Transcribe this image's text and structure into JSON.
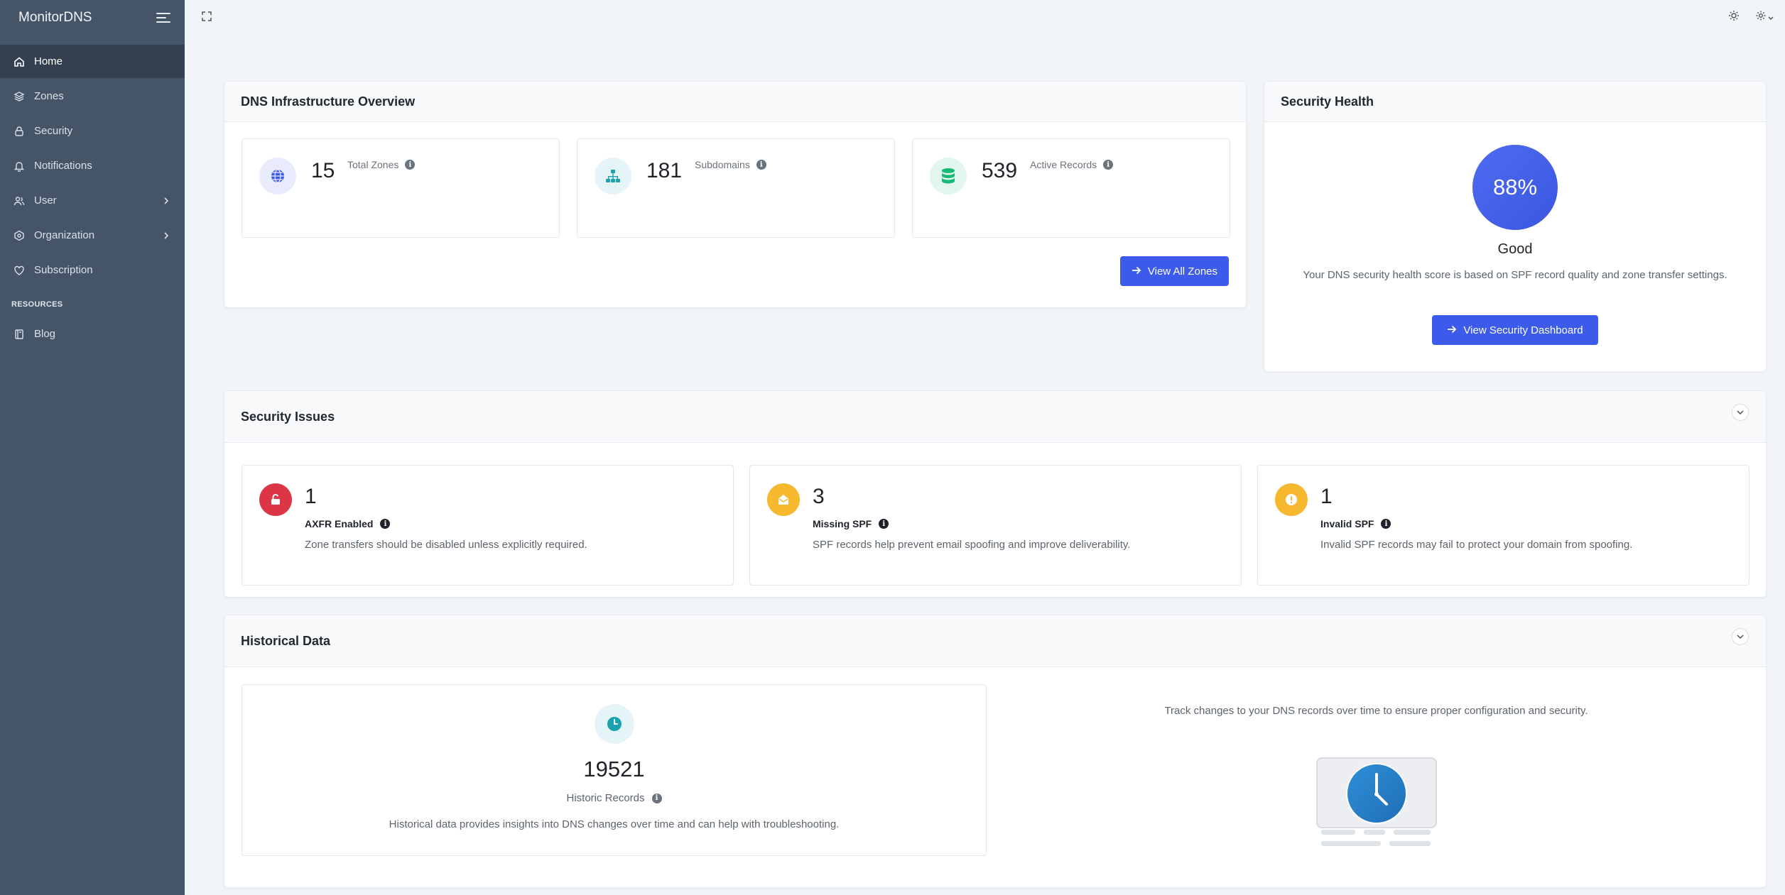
{
  "sidebar": {
    "brand": "MonitorDNS",
    "items": [
      {
        "label": "Home",
        "icon": "home-icon"
      },
      {
        "label": "Zones",
        "icon": "layers-icon"
      },
      {
        "label": "Security",
        "icon": "lock-icon"
      },
      {
        "label": "Notifications",
        "icon": "bell-icon"
      },
      {
        "label": "User",
        "icon": "users-icon"
      },
      {
        "label": "Organization",
        "icon": "organization-icon"
      },
      {
        "label": "Subscription",
        "icon": "heart-icon"
      }
    ],
    "section": "RESOURCES",
    "resources": [
      {
        "label": "Blog",
        "icon": "book-icon"
      }
    ]
  },
  "overview": {
    "title": "DNS Infrastructure Overview",
    "stats": [
      {
        "value": "15",
        "label": "Total Zones"
      },
      {
        "value": "181",
        "label": "Subdomains"
      },
      {
        "value": "539",
        "label": "Active Records"
      }
    ],
    "button": "View All Zones"
  },
  "health": {
    "title": "Security Health",
    "score": "88%",
    "score_value": 88,
    "status": "Good",
    "description": "Your DNS security health score is based on SPF record quality and zone transfer settings.",
    "button": "View Security Dashboard"
  },
  "issues": {
    "title": "Security Issues",
    "items": [
      {
        "value": "1",
        "label": "AXFR Enabled",
        "desc": "Zone transfers should be disabled unless explicitly required.",
        "color": "#dc3545"
      },
      {
        "value": "3",
        "label": "Missing SPF",
        "desc": "SPF records help prevent email spoofing and improve deliverability.",
        "color": "#f5b82e"
      },
      {
        "value": "1",
        "label": "Invalid SPF",
        "desc": "Invalid SPF records may fail to protect your domain from spoofing.",
        "color": "#f5b82e"
      }
    ]
  },
  "history": {
    "title": "Historical Data",
    "value": "19521",
    "label": "Historic Records",
    "desc": "Historical data provides insights into DNS changes over time and can help with troubleshooting.",
    "side_text": "Track changes to your DNS records over time to ensure proper configuration and security."
  },
  "colors": {
    "accent": "#3d5bea",
    "sidebar": "#465467",
    "danger": "#dc3545",
    "warning": "#f5b82e",
    "teal": "#1aa2b0",
    "success": "#17b978"
  }
}
